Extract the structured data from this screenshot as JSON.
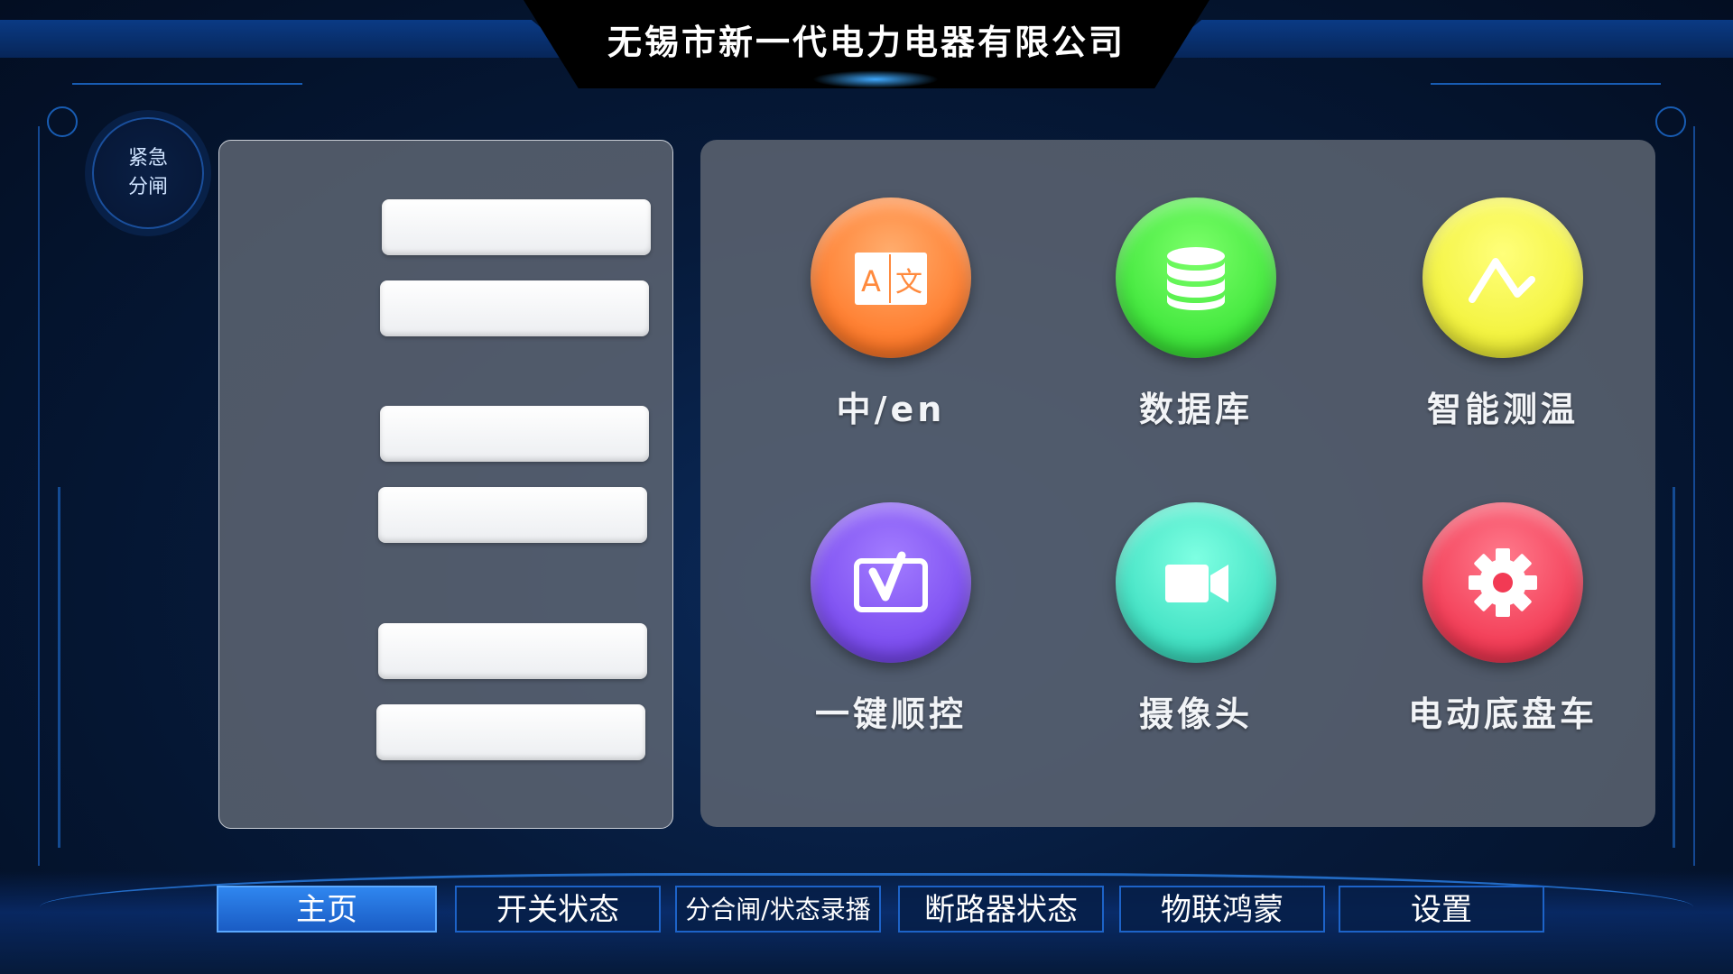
{
  "header": {
    "title": "无锡市新一代电力电器有限公司"
  },
  "emergency": {
    "label": "紧急分闸"
  },
  "left_panel": {
    "slots": [
      "",
      "",
      "",
      "",
      "",
      ""
    ]
  },
  "apps": [
    {
      "label": "中/en",
      "icon": "translate-icon",
      "color": "#ff8a3d"
    },
    {
      "label": "数据库",
      "icon": "database-icon",
      "color": "#3ee63a"
    },
    {
      "label": "智能测温",
      "icon": "temperature-chart-icon",
      "color": "#f2f23a"
    },
    {
      "label": "一键顺控",
      "icon": "yoast-y-icon",
      "color": "#7b4cf0"
    },
    {
      "label": "摄像头",
      "icon": "video-camera-icon",
      "color": "#3fe0c2"
    },
    {
      "label": "电动底盘车",
      "icon": "gear-icon",
      "color": "#f23a54"
    }
  ],
  "nav": {
    "tabs": [
      "主页",
      "开关状态",
      "分合闸/状态录播",
      "断路器状态",
      "物联鸿蒙",
      "设置"
    ],
    "active_index": 0
  }
}
